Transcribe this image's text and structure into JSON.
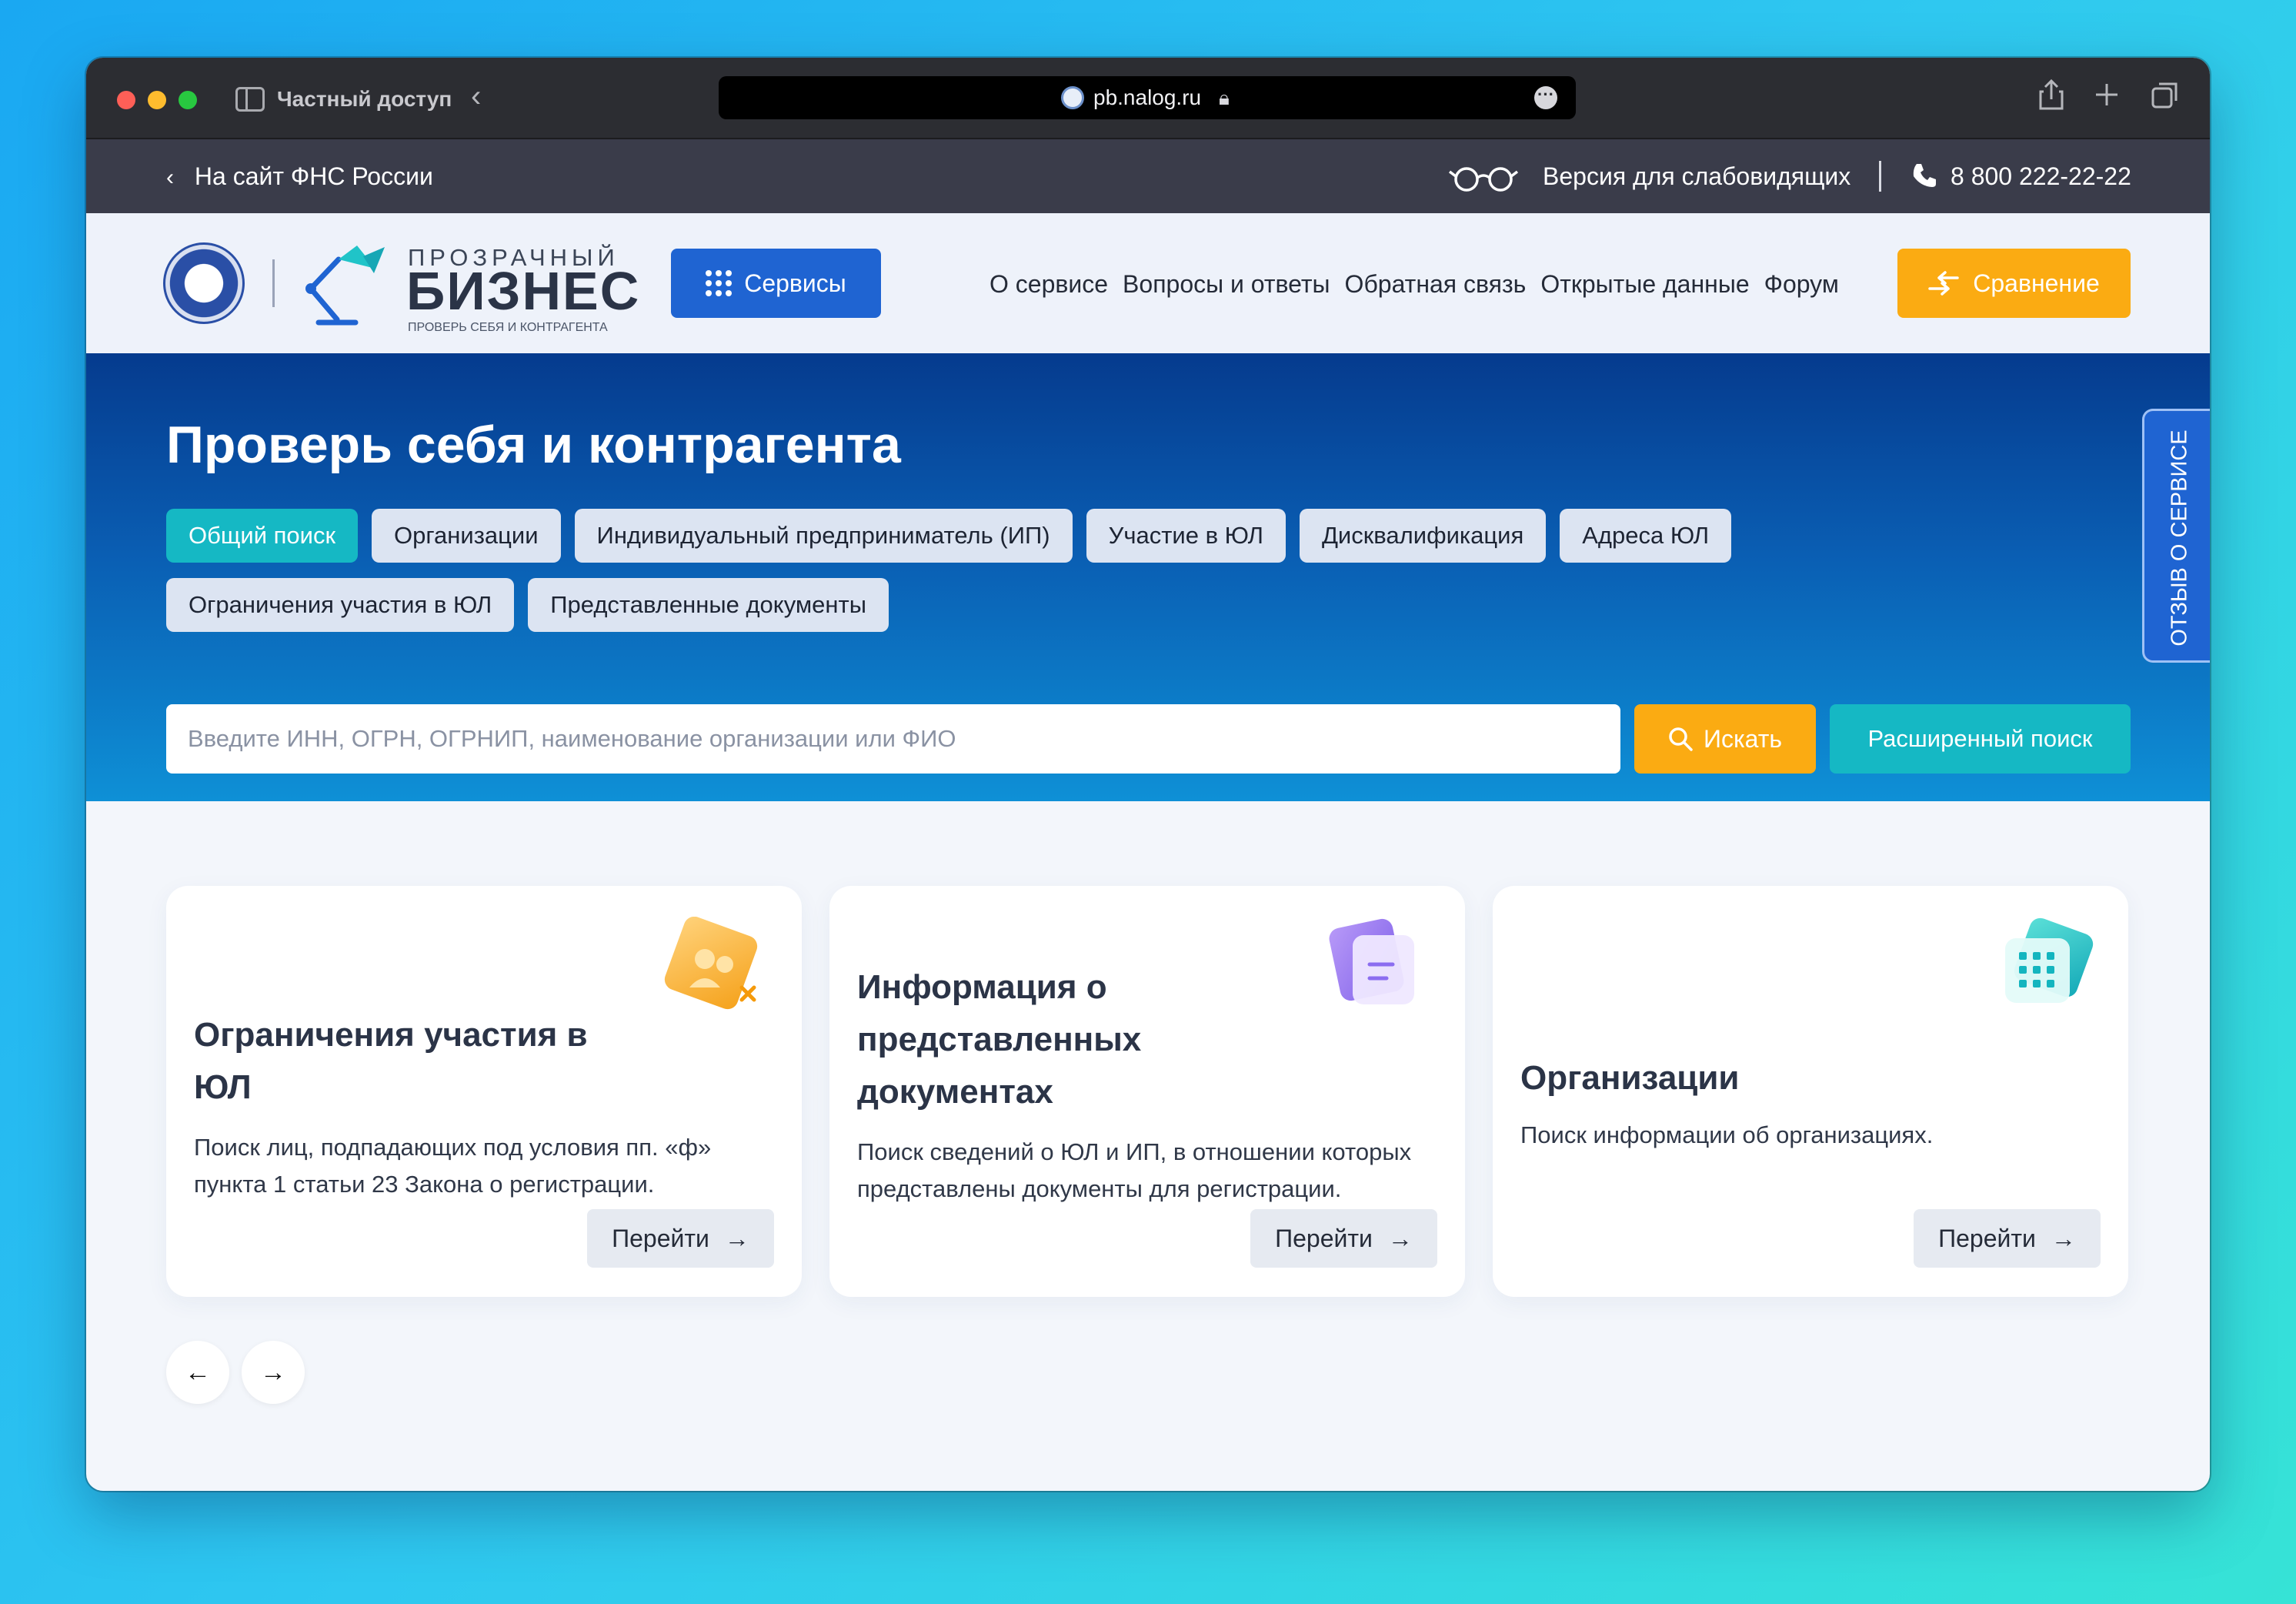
{
  "browser": {
    "private_label": "Частный доступ",
    "url": "pb.nalog.ru"
  },
  "topbar": {
    "back_link": "На сайт ФНС России",
    "visually_impaired": "Версия для слабовидящих",
    "phone": "8 800 222-22-22"
  },
  "header": {
    "brand_small": "ПРОЗРАЧНЫЙ",
    "brand_big": "БИЗНЕС",
    "brand_tagline": "ПРОВЕРЬ СЕБЯ И КОНТРАГЕНТА",
    "services_label": "Сервисы",
    "nav": [
      "О сервисе",
      "Вопросы и ответы",
      "Обратная связь",
      "Открытые данные",
      "Форум"
    ],
    "compare_label": "Сравнение"
  },
  "hero": {
    "title": "Проверь себя и контрагента",
    "chips": [
      "Общий поиск",
      "Организации",
      "Индивидуальный предприниматель (ИП)",
      "Участие в ЮЛ",
      "Дисквалификация",
      "Адреса ЮЛ",
      "Ограничения участия в ЮЛ",
      "Представленные документы"
    ],
    "search_placeholder": "Введите ИНН, ОГРН, ОГРНИП, наименование организации или ФИО",
    "search_label": "Искать",
    "advanced_label": "Расширенный поиск",
    "feedback_tab": "ОТЗЫВ О СЕРВИСЕ"
  },
  "cards": [
    {
      "title": "Ограничения участия в ЮЛ",
      "description": "Поиск лиц, подпадающих под условия пп. «ф» пункта 1 статьи 23 Закона о регистрации.",
      "button": "Перейти"
    },
    {
      "title": "Информация о представленных документах",
      "description": "Поиск сведений о ЮЛ и ИП, в отношении которых представлены документы для регистрации.",
      "button": "Перейти"
    },
    {
      "title": "Организации",
      "description": "Поиск информации об организациях.",
      "button": "Перейти"
    }
  ],
  "carousel": {
    "prev_icon": "←",
    "next_icon": "→"
  },
  "colors": {
    "accent_blue": "#1f64d2",
    "accent_orange": "#fbab12",
    "accent_teal": "#15b8c4",
    "topbar": "#3a3c4a"
  }
}
